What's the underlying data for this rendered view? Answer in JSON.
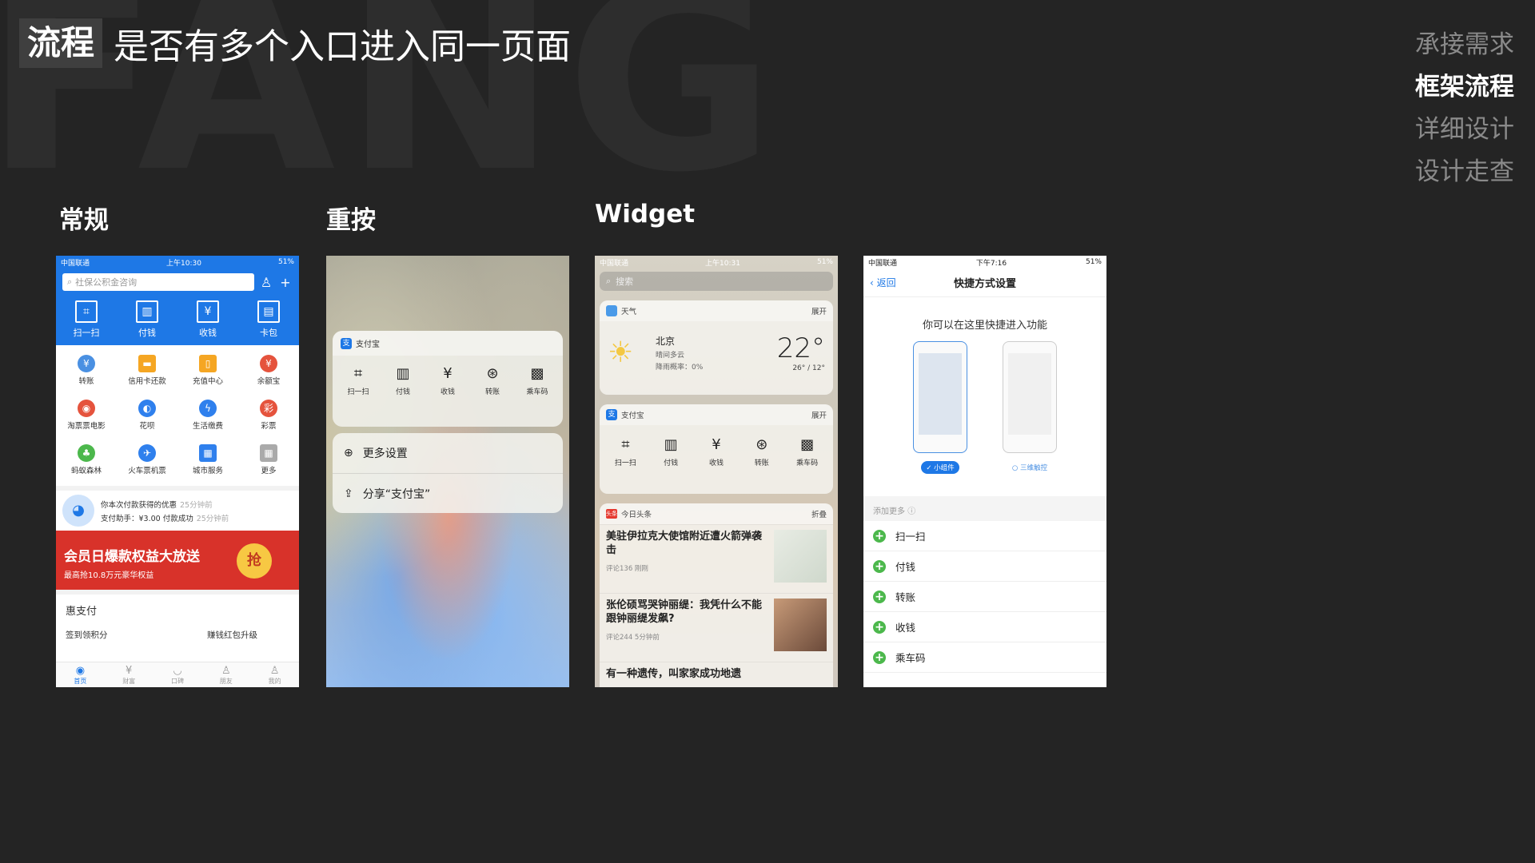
{
  "watermark": "FANG",
  "header": {
    "tag": "流程",
    "title": "是否有多个入口进入同一页面"
  },
  "nav": [
    {
      "label": "承接需求",
      "active": false
    },
    {
      "label": "框架流程",
      "active": true
    },
    {
      "label": "详细设计",
      "active": false
    },
    {
      "label": "设计走查",
      "active": false
    }
  ],
  "columns": {
    "regular": "常规",
    "force_touch": "重按",
    "widget": "Widget"
  },
  "phone1": {
    "status": {
      "carrier": "中国联通",
      "time": "上午10:30",
      "battery": "51%"
    },
    "search_placeholder": "社保公积金咨询",
    "quick": [
      {
        "label": "扫一扫",
        "icon": "scan-icon"
      },
      {
        "label": "付钱",
        "icon": "barcode-icon"
      },
      {
        "label": "收钱",
        "icon": "yuan-icon"
      },
      {
        "label": "卡包",
        "icon": "wallet-icon"
      }
    ],
    "grid": [
      {
        "label": "转账",
        "color": "#4a90e2"
      },
      {
        "label": "信用卡还款",
        "color": "#f5a623"
      },
      {
        "label": "充值中心",
        "color": "#f5a623"
      },
      {
        "label": "余额宝",
        "color": "#e5533d"
      },
      {
        "label": "淘票票电影",
        "color": "#e5533d"
      },
      {
        "label": "花呗",
        "color": "#2f80ed"
      },
      {
        "label": "生活缴费",
        "color": "#2f80ed"
      },
      {
        "label": "彩票",
        "color": "#e5533d"
      },
      {
        "label": "蚂蚁森林",
        "color": "#4cb84c"
      },
      {
        "label": "火车票机票",
        "color": "#2f80ed"
      },
      {
        "label": "城市服务",
        "color": "#2f80ed"
      },
      {
        "label": "更多",
        "color": "#aaaaaa"
      }
    ],
    "notice": [
      {
        "text": "你本次付款获得的优惠",
        "time": "25分钟前"
      },
      {
        "text": "支付助手：¥3.00 付款成功",
        "time": "25分钟前"
      }
    ],
    "banner": {
      "title": "会员日爆款权益大放送",
      "subtitle": "最高抢10.8万元豪华权益",
      "coin": "抢"
    },
    "hui": {
      "title": "惠支付",
      "left": "签到领积分",
      "right": "赚钱红包升级"
    },
    "tabs": [
      "首页",
      "财富",
      "口碑",
      "朋友",
      "我的"
    ]
  },
  "phone2": {
    "widget_title": "支付宝",
    "items": [
      "扫一扫",
      "付钱",
      "收钱",
      "转账",
      "乘车码"
    ],
    "menu": [
      "更多设置",
      "分享“支付宝”"
    ]
  },
  "phone3": {
    "status": {
      "carrier": "中国联通",
      "time": "上午10:31",
      "battery": "51%"
    },
    "search_placeholder": "搜索",
    "weather": {
      "header": "天气",
      "expand": "展开",
      "city": "北京",
      "desc": "晴间多云",
      "rain": "降雨概率：0%",
      "temp": "22°",
      "range": "26° / 12°"
    },
    "alipay": {
      "header": "支付宝",
      "expand": "展开",
      "items": [
        "扫一扫",
        "付钱",
        "收钱",
        "转账",
        "乘车码"
      ]
    },
    "news": {
      "header": "今日头条",
      "collapse": "折叠",
      "items": [
        {
          "title": "美驻伊拉克大使馆附近遭火箭弹袭击",
          "meta": "评论136  刚刚"
        },
        {
          "title": "张伦硕骂哭钟丽缇：我凭什么不能跟钟丽缇发飙?",
          "meta": "评论244  5分钟前"
        },
        {
          "title": "有一种遗传，叫家家成功地遗",
          "meta": ""
        }
      ]
    }
  },
  "phone4": {
    "status": {
      "carrier": "中国联通",
      "time": "下午7:16",
      "battery": "51%"
    },
    "back": "返回",
    "title": "快捷方式设置",
    "intro": "你可以在这里快捷进入功能",
    "options": [
      {
        "label": "小组件",
        "selected": true
      },
      {
        "label": "三维触控",
        "selected": false
      }
    ],
    "section": "添加更多",
    "rows": [
      "扫一扫",
      "付钱",
      "转账",
      "收钱",
      "乘车码"
    ]
  }
}
